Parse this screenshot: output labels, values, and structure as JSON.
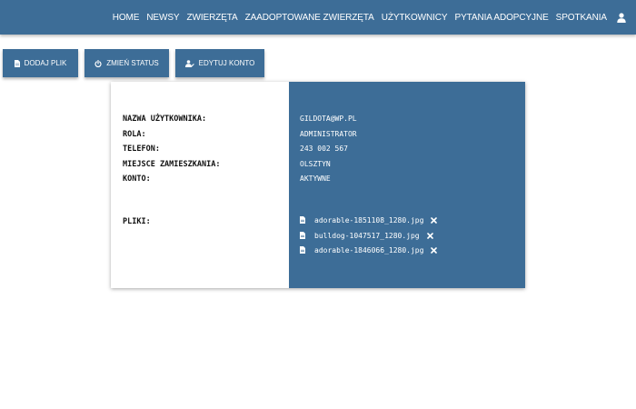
{
  "nav": {
    "items": [
      {
        "label": "HOME"
      },
      {
        "label": "NEWSY"
      },
      {
        "label": "ZWIERZĘTA"
      },
      {
        "label": "ZAADOPTOWANE ZWIERZĘTA"
      },
      {
        "label": "UŻYTKOWNICY"
      },
      {
        "label": "PYTANIA ADOPCYJNE"
      },
      {
        "label": "SPOTKANIA"
      }
    ],
    "user_icon": "user-icon"
  },
  "toolbar": {
    "add_file_label": "DODAJ PLIK",
    "add_file_icon": "file-icon",
    "change_status_label": "ZMIEŃ STATUS",
    "change_status_icon": "power-icon",
    "edit_account_label": "EDYTUJ KONTO",
    "edit_account_icon": "user-edit-icon"
  },
  "profile": {
    "labels": {
      "username": "NAZWA UŻYTKOWNIKA:",
      "role": "ROLA:",
      "phone": "TELEFON:",
      "residence": "MIEJSCE ZAMIESZKANIA:",
      "account": "KONTO:",
      "files": "PLIKI:"
    },
    "values": {
      "username": "GILDOTA@WP.PL",
      "role": "ADMINISTRATOR",
      "phone": "243 002 567",
      "residence": "OLSZTYN",
      "account": "AKTYWNE"
    },
    "files": [
      {
        "name": "adorable-1851108_1280.jpg"
      },
      {
        "name": "bulldog-1047517_1280.jpg"
      },
      {
        "name": "adorable-1846066_1280.jpg"
      }
    ]
  },
  "colors": {
    "primary": "#3d6d97",
    "text_dark": "#111111",
    "text_light": "#ffffff"
  }
}
